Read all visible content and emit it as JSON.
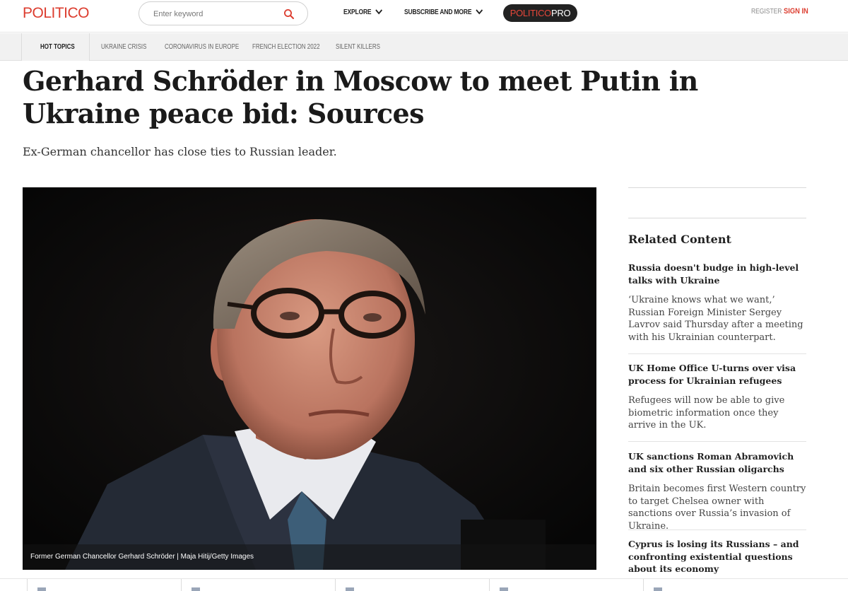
{
  "header": {
    "logo": "POLITICO",
    "search_placeholder": "Enter keyword",
    "nav": [
      {
        "label": "EXPLORE"
      },
      {
        "label": "SUBSCRIBE AND MORE"
      }
    ],
    "pro_politico": "POLITICO",
    "pro_suffix": "PRO",
    "register": "REGISTER",
    "signin": "SIGN IN",
    "accent": "#dc3c2e"
  },
  "topics": {
    "label": "HOT TOPICS",
    "items": [
      "UKRAINE CRISIS",
      "CORONAVIRUS IN EUROPE",
      "FRENCH ELECTION 2022",
      "SILENT KILLERS"
    ]
  },
  "article": {
    "headline": "Gerhard Schröder in Moscow to meet Putin in Ukraine peace bid: Sources",
    "dek": "Ex-German chancellor has close ties to Russian leader.",
    "image_caption": "Former German Chancellor Gerhard Schröder | Maja Hitij/Getty Images"
  },
  "related": {
    "title": "Related Content",
    "items": [
      {
        "headline": "Russia doesn't budge in high-level talks with Ukraine",
        "summary": "‘Ukraine knows what we want,’ Russian Foreign Minister Sergey Lavrov said Thursday after a meeting with his Ukrainian counterpart."
      },
      {
        "headline": "UK Home Office U-turns over visa process for Ukrainian refugees",
        "summary": "Refugees will now be able to give biometric information once they arrive in the UK."
      },
      {
        "headline": "UK sanctions Roman Abramovich and six other Russian oligarchs",
        "summary": "Britain becomes first Western country to target Chelsea owner with sanctions over Russia’s invasion of Ukraine."
      },
      {
        "headline": "Cyprus is losing its Russians – and confronting existential questions about its economy",
        "summary": ""
      }
    ]
  }
}
